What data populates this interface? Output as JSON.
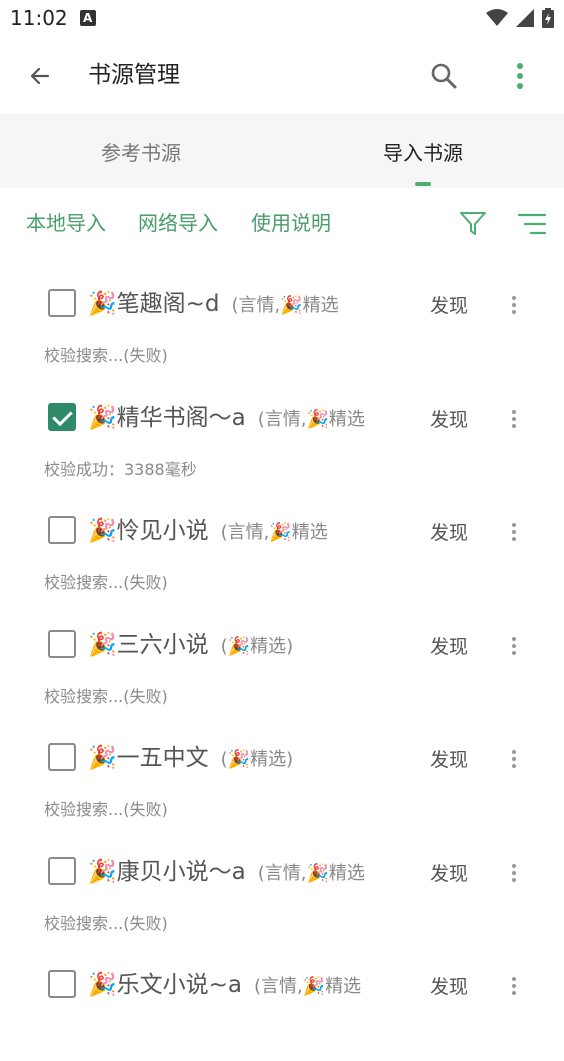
{
  "status_bar": {
    "time": "11:02",
    "notification_icon": "A"
  },
  "toolbar": {
    "title": "书源管理"
  },
  "tabs": [
    {
      "label": "参考书源",
      "active": false
    },
    {
      "label": "导入书源",
      "active": true
    }
  ],
  "actions": {
    "local_import": "本地导入",
    "network_import": "网络导入",
    "usage": "使用说明"
  },
  "colors": {
    "accent": "#4caf72",
    "link": "#4a9d6a",
    "checked": "#2f8a68"
  },
  "items": [
    {
      "name": "🎉笔趣阁~d",
      "group": "(言情,🎉精选",
      "discover": "发现",
      "status": "校验搜索...(失败)",
      "checked": false
    },
    {
      "name": "🎉精华书阁～a",
      "group": "(言情,🎉精选",
      "discover": "发现",
      "status": "校验成功：3388毫秒",
      "checked": true
    },
    {
      "name": "🎉怜见小说",
      "group": "(言情,🎉精选",
      "discover": "发现",
      "status": "校验搜索...(失败)",
      "checked": false
    },
    {
      "name": "🎉三六小说",
      "group": "(🎉精选)",
      "discover": "发现",
      "status": "校验搜索...(失败)",
      "checked": false
    },
    {
      "name": "🎉一五中文",
      "group": "(🎉精选)",
      "discover": "发现",
      "status": "校验搜索...(失败)",
      "checked": false
    },
    {
      "name": "🎉康贝小说～a",
      "group": "(言情,🎉精选",
      "discover": "发现",
      "status": "校验搜索...(失败)",
      "checked": false
    },
    {
      "name": "🎉乐文小说~a",
      "group": "(言情,🎉精选",
      "discover": "发现",
      "status": "",
      "checked": false
    }
  ]
}
